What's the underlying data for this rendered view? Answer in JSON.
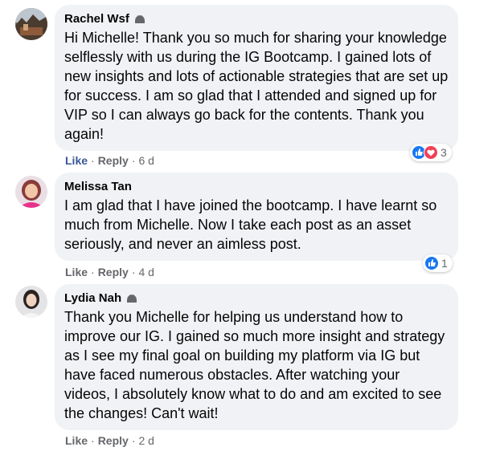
{
  "comments": [
    {
      "author": "Rachel Wsf",
      "text": "Hi Michelle! Thank you so much for sharing your knowledge selflessly with us during the IG Bootcamp. I gained lots of new insights and lots of actionable strategies that are set up for success. I am so glad that I attended and signed up for VIP so I can always go back for the contents. Thank you again!",
      "like": "Like",
      "reply": "Reply",
      "time": "6 d",
      "reaction_count": "3",
      "reactions": [
        "like-icon",
        "love-icon"
      ],
      "badge": "top-fan-badge-icon"
    },
    {
      "author": "Melissa Tan",
      "text": "I am glad that I have joined the bootcamp. I have learnt so much from Michelle. Now I take each post as an asset seriously, and never an aimless post.",
      "like": "Like",
      "reply": "Reply",
      "time": "4 d",
      "reaction_count": "1",
      "reactions": [
        "like-icon"
      ]
    },
    {
      "author": "Lydia Nah",
      "text": "Thank you Michelle for helping us understand how to improve our IG. I gained so much more insight and strategy as I see my final goal on building my platform via IG but have faced numerous obstacles. After watching your videos, I absolutely know what to do and am excited to see the changes! Can't wait!",
      "like": "Like",
      "reply": "Reply",
      "time": "2 d",
      "badge": "top-fan-badge-icon"
    }
  ],
  "separator": "·",
  "colors": {
    "bubble": "#f0f2f5",
    "meta_text": "#65676b",
    "like_blue": "#1877f2",
    "love_red": "#f33e58"
  }
}
